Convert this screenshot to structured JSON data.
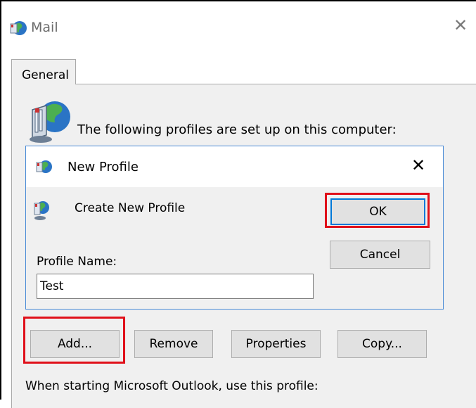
{
  "outer_window": {
    "title": "Mail",
    "close_glyph": "✕",
    "tab_label": "General",
    "profiles_text": "The following profiles are set up on this computer:",
    "add_label": "Add...",
    "remove_label": "Remove",
    "properties_label": "Properties",
    "copy_label": "Copy...",
    "startup_text": "When starting Microsoft Outlook, use this profile:"
  },
  "dialog": {
    "title": "New Profile",
    "close_glyph": "✕",
    "create_label": "Create New Profile",
    "ok_label": "OK",
    "cancel_label": "Cancel",
    "profile_name_label": "Profile Name:",
    "profile_name_value": "Test"
  },
  "colors": {
    "highlight": "#e0101a",
    "focus_border": "#0078d7",
    "dialog_border": "#4a8bd6"
  },
  "icons": {
    "app": "mail-globe-icon",
    "profiles": "mail-globe-large-icon",
    "create_profile": "mail-globe-small-icon"
  }
}
